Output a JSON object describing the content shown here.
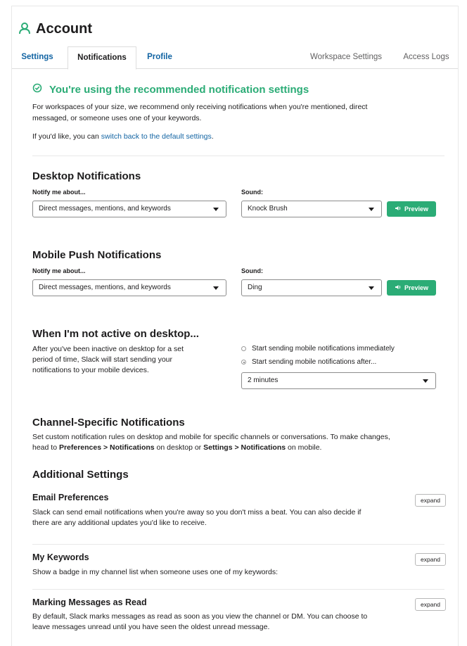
{
  "header": {
    "icon": "user-icon",
    "title": "Account",
    "accent": "#2bac76"
  },
  "tabs": [
    {
      "label": "Settings"
    },
    {
      "label": "Notifications"
    },
    {
      "label": "Profile"
    },
    {
      "label": "Workspace Settings"
    },
    {
      "label": "Access Logs"
    }
  ],
  "recommended": {
    "icon": "check-circle-icon",
    "title": "You're using the recommended notification settings",
    "desc_line1": "For workspaces of your size, we recommend only receiving notifications when you're mentioned, direct",
    "desc_line2": "messaged, or someone uses one of your keywords.",
    "switch_prefix": "If you'd like, you can ",
    "switch_link": "switch back to the default settings",
    "switch_suffix": "."
  },
  "desktop": {
    "title": "Desktop Notifications",
    "notify_label": "Notify me about...",
    "notify_value": "Direct messages, mentions, and keywords",
    "sound_label": "Sound:",
    "sound_value": "Knock Brush",
    "preview_label": "Preview"
  },
  "mobile": {
    "title": "Mobile Push Notifications",
    "notify_label": "Notify me about...",
    "notify_value": "Direct messages, mentions, and keywords",
    "sound_label": "Sound:",
    "sound_value": "Ding",
    "preview_label": "Preview"
  },
  "inactive": {
    "title": "When I'm not active on desktop...",
    "desc_line1": "After you've been inactive on desktop for a set",
    "desc_line2": "period of time, Slack will start sending your",
    "desc_line3": "notifications to your mobile devices.",
    "option_immediately": "Start sending mobile notifications immediately",
    "option_after": "Start sending mobile notifications after...",
    "selected_option": "after",
    "delay_value": "2 minutes"
  },
  "channel_specific": {
    "title": "Channel-Specific Notifications",
    "line1": "Set custom notification rules on desktop and mobile for specific channels or conversations. To make changes,",
    "line2_a": "head to ",
    "line2_b": "Preferences > Notifications",
    "line2_c": " on desktop or ",
    "line2_d": "Settings > Notifications",
    "line2_e": " on mobile."
  },
  "additional": {
    "title": "Additional Settings",
    "expand_label": "expand",
    "email": {
      "title": "Email Preferences",
      "line1": "Slack can send email notifications when you're away so you don't miss a beat. You can also decide if",
      "line2": "there are any additional updates you'd like to receive."
    },
    "keywords": {
      "title": "My Keywords",
      "line1": "Show a badge in my channel list when someone uses one of my keywords:"
    },
    "marking": {
      "title": "Marking Messages as Read",
      "line1": "By default, Slack marks messages as read as soon as you view the channel or DM. You can choose to",
      "line2": "leave messages unread until you have seen the oldest unread message."
    }
  }
}
